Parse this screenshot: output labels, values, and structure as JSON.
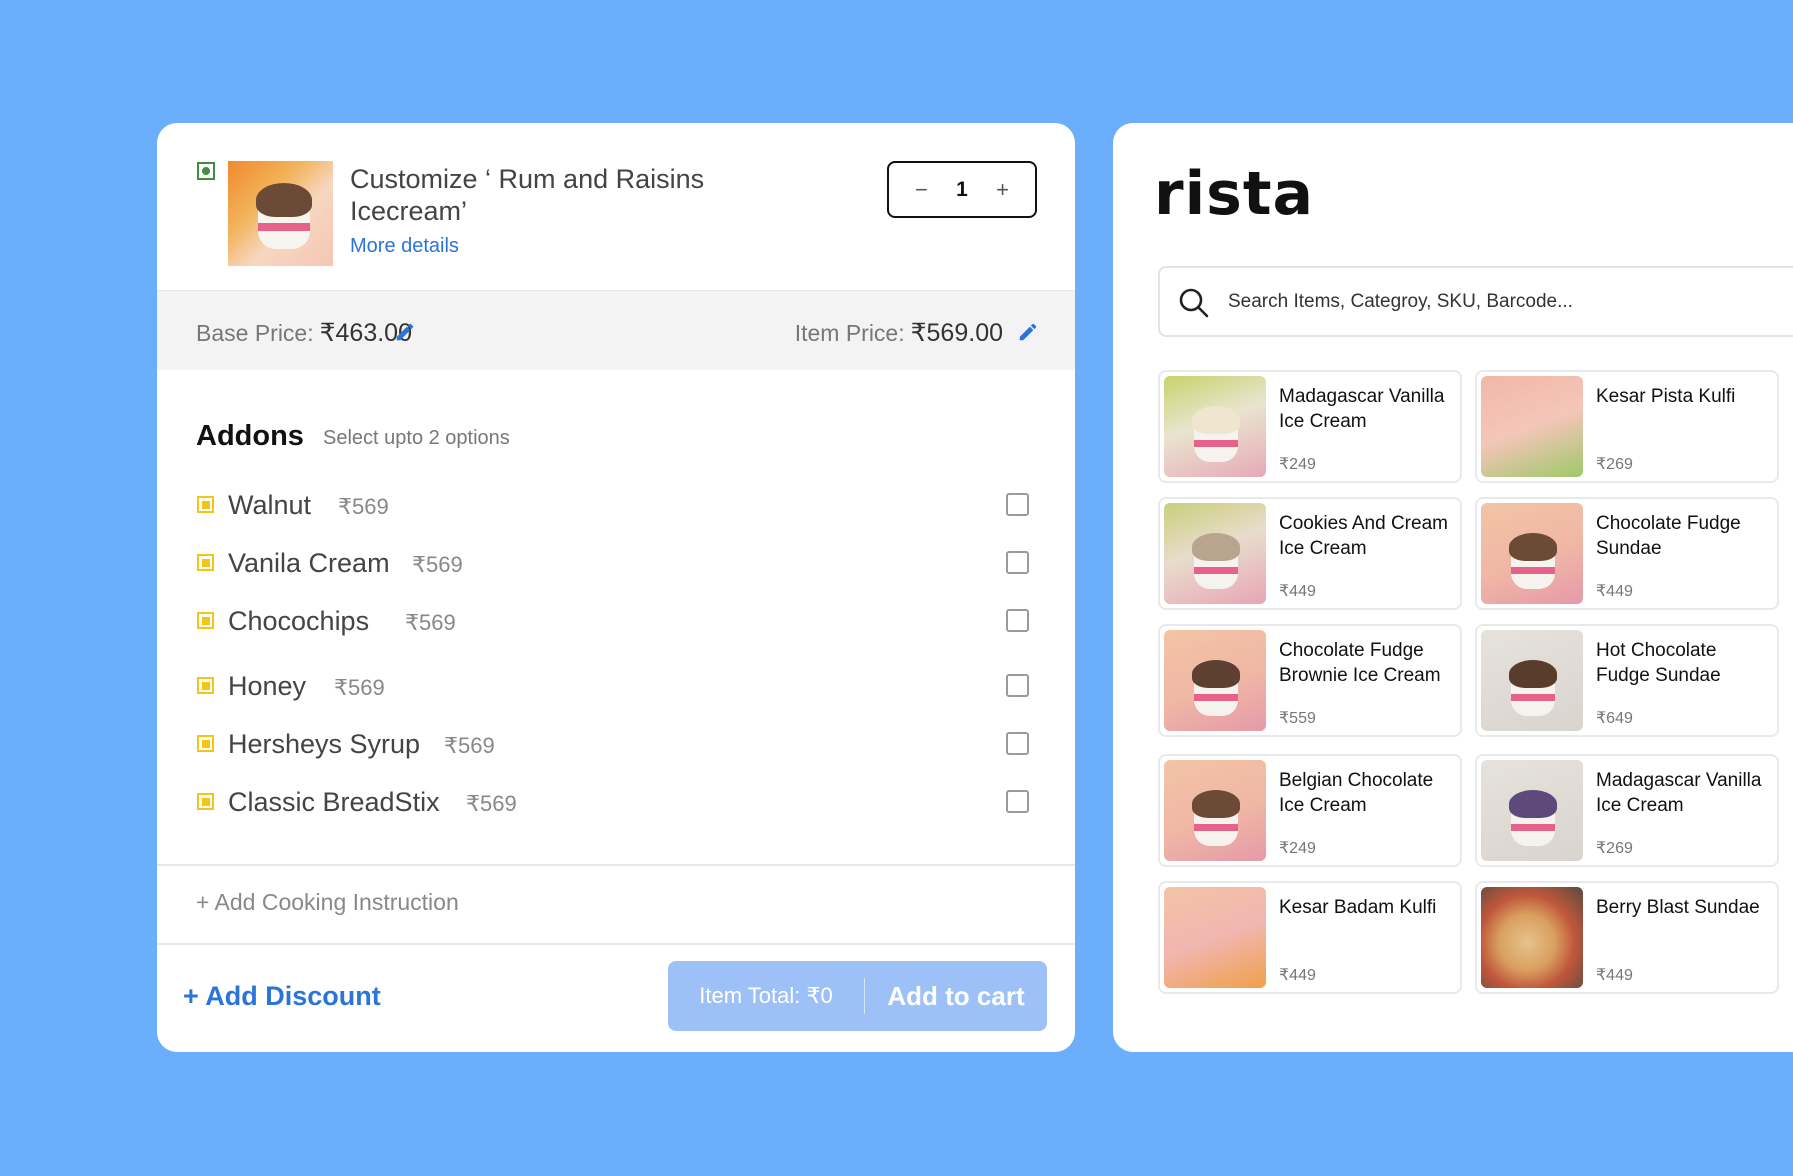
{
  "product": {
    "title": "Customize ‘ Rum and Raisins Icecream’",
    "more_details": "More details",
    "quantity": "1",
    "minus": "−",
    "plus": "+"
  },
  "prices": {
    "base_label": "Base Price:",
    "base_value": "₹463.00",
    "item_label": "Item Price:",
    "item_value": "₹569.00"
  },
  "addons": {
    "title": "Addons",
    "subtitle": "Select upto 2 options",
    "items": [
      {
        "name": "Walnut",
        "price": "₹569"
      },
      {
        "name": "Vanila Cream",
        "price": "₹569"
      },
      {
        "name": "Chocochips",
        "price": "₹569"
      },
      {
        "name": "Honey",
        "price": "₹569"
      },
      {
        "name": "Hersheys Syrup",
        "price": "₹569"
      },
      {
        "name": "Classic BreadStix",
        "price": "₹569"
      }
    ]
  },
  "footer": {
    "cooking_instruction": "+ Add Cooking Instruction",
    "add_discount": "+ Add Discount",
    "item_total": "Item Total: ₹0",
    "add_to_cart": "Add to cart"
  },
  "catalog": {
    "logo": "rista",
    "search_placeholder": "Search Items, Categroy, SKU, Barcode...",
    "items": [
      {
        "name": "Madagascar Vanilla Ice Cream",
        "price": "₹249"
      },
      {
        "name": "Kesar Pista Kulfi",
        "price": "₹269"
      },
      {
        "name": "Cookies And Cream Ice Cream",
        "price": "₹449"
      },
      {
        "name": "Chocolate Fudge Sundae",
        "price": "₹449"
      },
      {
        "name": "Chocolate Fudge Brownie Ice Cream",
        "price": "₹559"
      },
      {
        "name": "Hot Chocolate Fudge Sundae",
        "price": "₹649"
      },
      {
        "name": "Belgian Chocolate Ice Cream",
        "price": "₹249"
      },
      {
        "name": "Madagascar Vanilla Ice Cream",
        "price": "₹269"
      },
      {
        "name": "Kesar Badam Kulfi",
        "price": "₹449"
      },
      {
        "name": "Berry Blast Sundae",
        "price": "₹449"
      }
    ]
  },
  "colors": {
    "background": "#6aaefc",
    "accent": "#2b74d9",
    "veg": "#3f8f3f",
    "addon_mark": "#f3c516",
    "cart_button": "#9dc1f7"
  }
}
